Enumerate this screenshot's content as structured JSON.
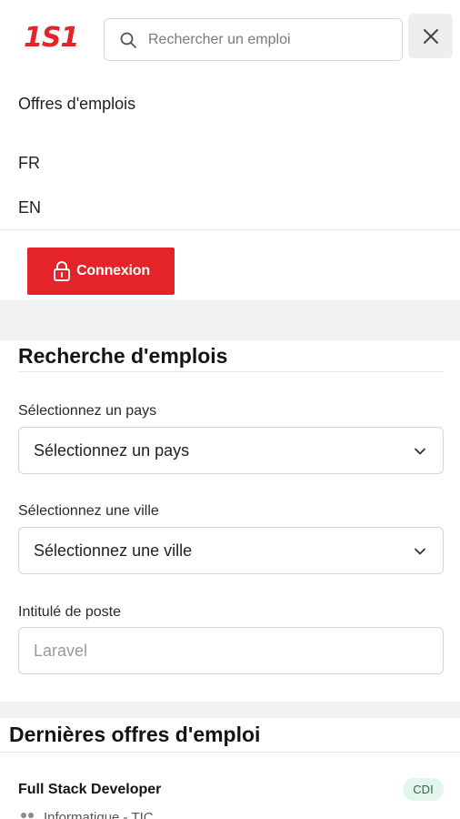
{
  "header": {
    "logo_text": "1S1",
    "search_placeholder": "Rechercher un emploi",
    "search_icon": "search-icon",
    "close_icon": "close-icon"
  },
  "menu": {
    "items": [
      {
        "label": "Offres d'emplois"
      },
      {
        "label": "FR"
      },
      {
        "label": "EN"
      }
    ],
    "login_label": "Connexion",
    "login_icon": "lock-icon"
  },
  "search_form": {
    "title": "Recherche d'emplois",
    "country_label": "Sélectionnez un pays",
    "country_value": "Sélectionnez un pays",
    "city_label": "Sélectionnez une ville",
    "city_value": "Sélectionnez une ville",
    "job_title_label": "Intitulé de poste",
    "job_title_placeholder": "Laravel"
  },
  "latest_jobs": {
    "title": "Dernières offres d'emploi",
    "items": [
      {
        "title": "Full Stack Developer",
        "badge": "CDI",
        "category": "Informatique - TIC"
      }
    ]
  },
  "colors": {
    "brand_red": "#e52429",
    "badge_bg": "#e3f6ec",
    "band_gray": "#f2f2f3"
  }
}
